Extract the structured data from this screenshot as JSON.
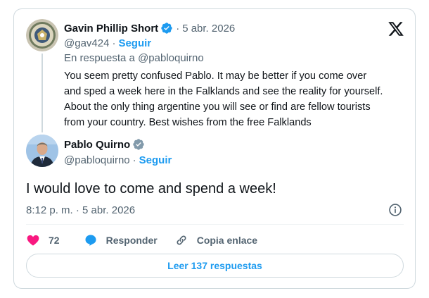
{
  "parent_tweet": {
    "author_name": "Gavin Phillip Short",
    "verified_icon": "verified-badge-blue",
    "separator": "·",
    "date": "5 abr. 2026",
    "handle": "@gav424",
    "follow_label": "Seguir",
    "reply_to": "En respuesta a @pabloquirno",
    "text_lines": [
      "You seem pretty confused Pablo. It may be better if you come over",
      "and sped a week here in the Falklands and see the reality for yourself.",
      "About the only thing argentine you will see or find are fellow tourists",
      "from your country. Best wishes from the free Falklands"
    ]
  },
  "main_tweet": {
    "author_name": "Pablo Quirno",
    "verified_icon": "verified-badge-gray",
    "handle": "@pabloquirno",
    "separator": "·",
    "follow_label": "Seguir",
    "text": "I would love to come and spend a week!",
    "timestamp": "8:12 p. m. · 5 abr. 2026"
  },
  "actions": {
    "like_count": "72",
    "reply_label": "Responder",
    "copy_label": "Copia enlace"
  },
  "read_replies_label": "Leer 137 respuestas",
  "colors": {
    "accent": "#1d9bf0",
    "like": "#f91880",
    "muted": "#536471",
    "border": "#cfd9de"
  }
}
